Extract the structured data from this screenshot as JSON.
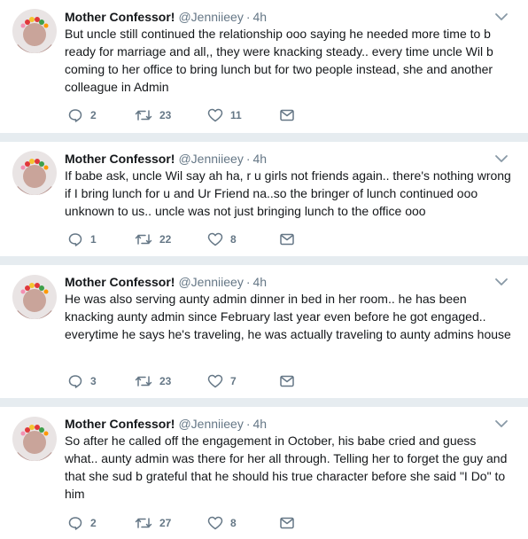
{
  "tweets": [
    {
      "name": "Mother Confessor!",
      "handle": "@Jenniieey",
      "dot": "·",
      "time": "4h",
      "text": "But uncle still continued the relationship ooo saying he needed more time to b ready for marriage and all,, they were knacking steady.. every time uncle Wil b coming to her office to bring lunch but for two people instead, she and another colleague in Admin",
      "replies": "2",
      "retweets": "23",
      "likes": "11"
    },
    {
      "name": "Mother Confessor!",
      "handle": "@Jenniieey",
      "dot": "·",
      "time": "4h",
      "text": "If babe ask, uncle Wil say ah ha, r u girls not friends again.. there's nothing wrong if I bring lunch for u and Ur Friend na..so the bringer of lunch continued ooo unknown to us.. uncle was not just bringing lunch to the office ooo",
      "replies": "1",
      "retweets": "22",
      "likes": "8"
    },
    {
      "name": "Mother Confessor!",
      "handle": "@Jenniieey",
      "dot": "·",
      "time": "4h",
      "text": "He was also serving aunty admin dinner in bed in her room.. he has been knacking aunty admin since February last year even before he got engaged.. everytime he says he's traveling, he was actually traveling to aunty admins house",
      "replies": "3",
      "retweets": "23",
      "likes": "7"
    },
    {
      "name": "Mother Confessor!",
      "handle": "@Jenniieey",
      "dot": "·",
      "time": "4h",
      "text": "So after he called off the engagement in October, his babe cried and guess what.. aunty admin was there for her all through. Telling her to forget the guy and that she sud b grateful that he should his true character before she said \"I Do\" to him",
      "replies": "2",
      "retweets": "27",
      "likes": "8"
    }
  ],
  "icons": {
    "reply": "reply-icon",
    "retweet": "retweet-icon",
    "like": "heart-icon",
    "dm": "envelope-icon",
    "caret": "chevron-down-icon"
  },
  "colors": {
    "text": "#14171a",
    "secondary": "#657786",
    "separator": "#e6ecf0"
  }
}
